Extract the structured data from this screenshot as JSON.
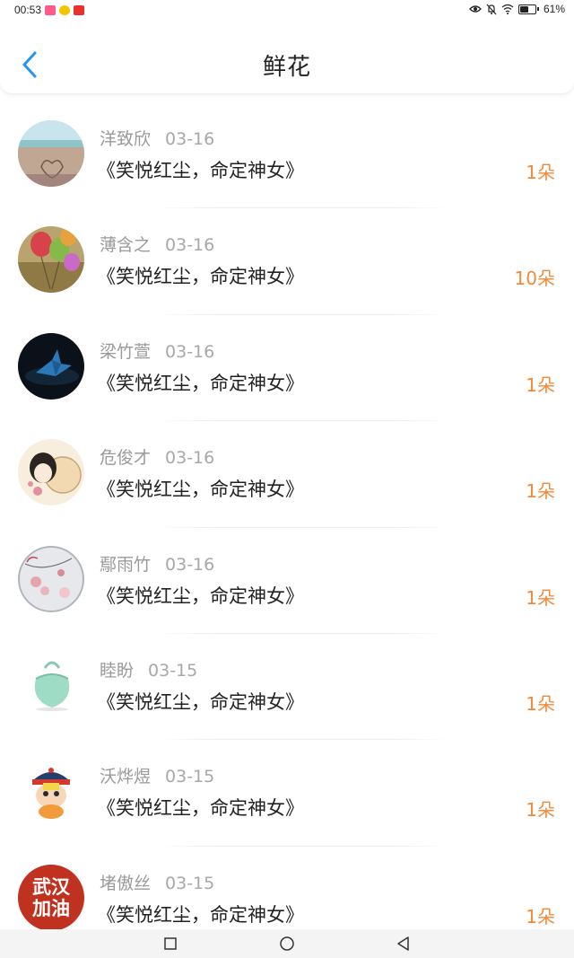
{
  "status_bar": {
    "time": "00:53",
    "battery_text": "61%",
    "battery_level": 0.61,
    "icons": [
      "eye-icon",
      "bell-off-icon",
      "wifi-icon",
      "battery-icon"
    ]
  },
  "header": {
    "title": "鲜花",
    "back_icon": "chevron-left-icon",
    "accent_color": "#2196F3"
  },
  "list": {
    "accent_count_color": "#F08A3A",
    "items": [
      {
        "name": "洋致欣",
        "date": "03-16",
        "book": "《笑悦红尘，命定神女》",
        "count": "1朵",
        "avatar": "beach-heart"
      },
      {
        "name": "薄含之",
        "date": "03-16",
        "book": "《笑悦红尘，命定神女》",
        "count": "10朵",
        "avatar": "balloons"
      },
      {
        "name": "梁竹萱",
        "date": "03-16",
        "book": "《笑悦红尘，命定神女》",
        "count": "1朵",
        "avatar": "paper-crane"
      },
      {
        "name": "危俊才",
        "date": "03-16",
        "book": "《笑悦红尘，命定神女》",
        "count": "1朵",
        "avatar": "girl-fan"
      },
      {
        "name": "鄢雨竹",
        "date": "03-16",
        "book": "《笑悦红尘，命定神女》",
        "count": "1朵",
        "avatar": "blossom"
      },
      {
        "name": "睦盼",
        "date": "03-15",
        "book": "《笑悦红尘，命定神女》",
        "count": "1朵",
        "avatar": "mint-bag"
      },
      {
        "name": "沃烨煜",
        "date": "03-15",
        "book": "《笑悦红尘，命定神女》",
        "count": "1朵",
        "avatar": "cartoon-figure"
      },
      {
        "name": "堵傲丝",
        "date": "03-15",
        "book": "《笑悦红尘，命定神女》",
        "count": "1朵",
        "avatar": "wuhan-jiayou"
      }
    ],
    "avatar_text_last": [
      "武汉",
      "加油"
    ]
  },
  "nav_bar": {
    "icons": [
      "recent-apps-icon",
      "home-icon",
      "back-triangle-icon"
    ]
  }
}
